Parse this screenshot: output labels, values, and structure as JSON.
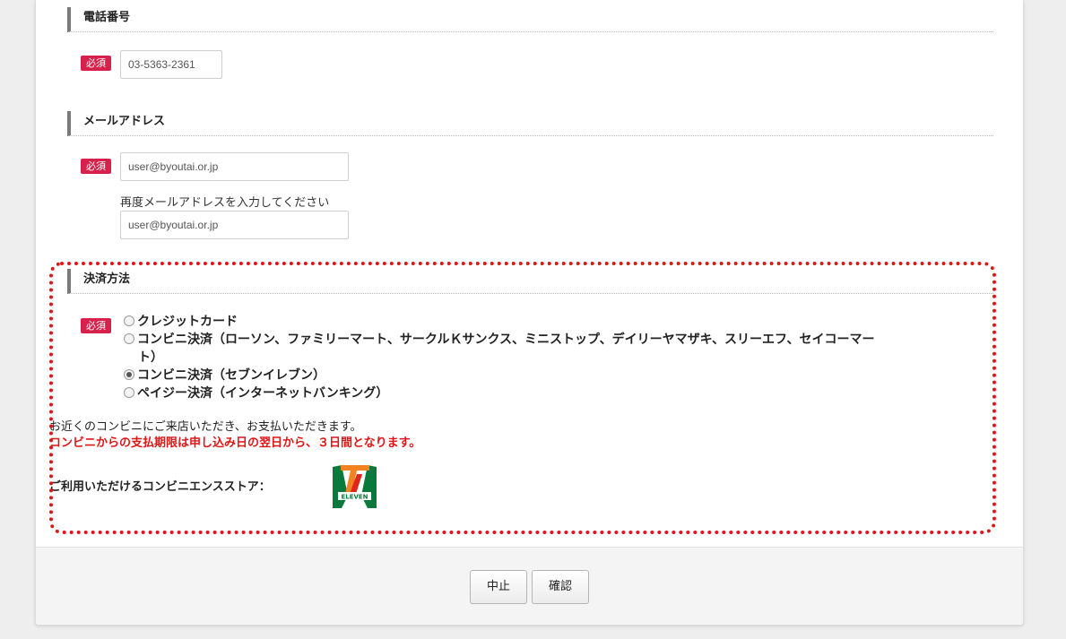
{
  "sections": {
    "phone": {
      "title": "電話番号",
      "value": "03-5363-2361"
    },
    "email": {
      "title": "メールアドレス",
      "value": "user@byoutai.or.jp",
      "confirm_hint": "再度メールアドレスを入力してください",
      "confirm_value": "user@byoutai.or.jp"
    },
    "payment": {
      "title": "決済方法",
      "options": [
        {
          "label": "クレジットカード",
          "selected": false
        },
        {
          "label": "コンビニ決済（ローソン、ファミリーマート、サークルＫサンクス、ミニストップ、デイリーヤマザキ、スリーエフ、セイコーマー",
          "label_cont": "ト）",
          "selected": false
        },
        {
          "label": "コンビニ決済（セブンイレブン）",
          "selected": true
        },
        {
          "label": "ペイジー決済（インターネットバンキング）",
          "selected": false
        }
      ],
      "note": "お近くのコンビニにご来店いただき、お支払いただきます。",
      "deadline_note": "コンビニからの支払期限は申し込み日の翌日から、３日間となります。",
      "store_label": "ご利用いただけるコンビニエンスストア：",
      "store_logo_text": "ELEVEN"
    }
  },
  "required_badge": "必須",
  "footer": {
    "cancel_label": "中止",
    "confirm_label": "確認"
  },
  "colors": {
    "required": "#d7214c",
    "highlight": "#e01515",
    "logo_green": "#0a7a3c",
    "logo_orange": "#f58220",
    "logo_red": "#e0261b"
  }
}
